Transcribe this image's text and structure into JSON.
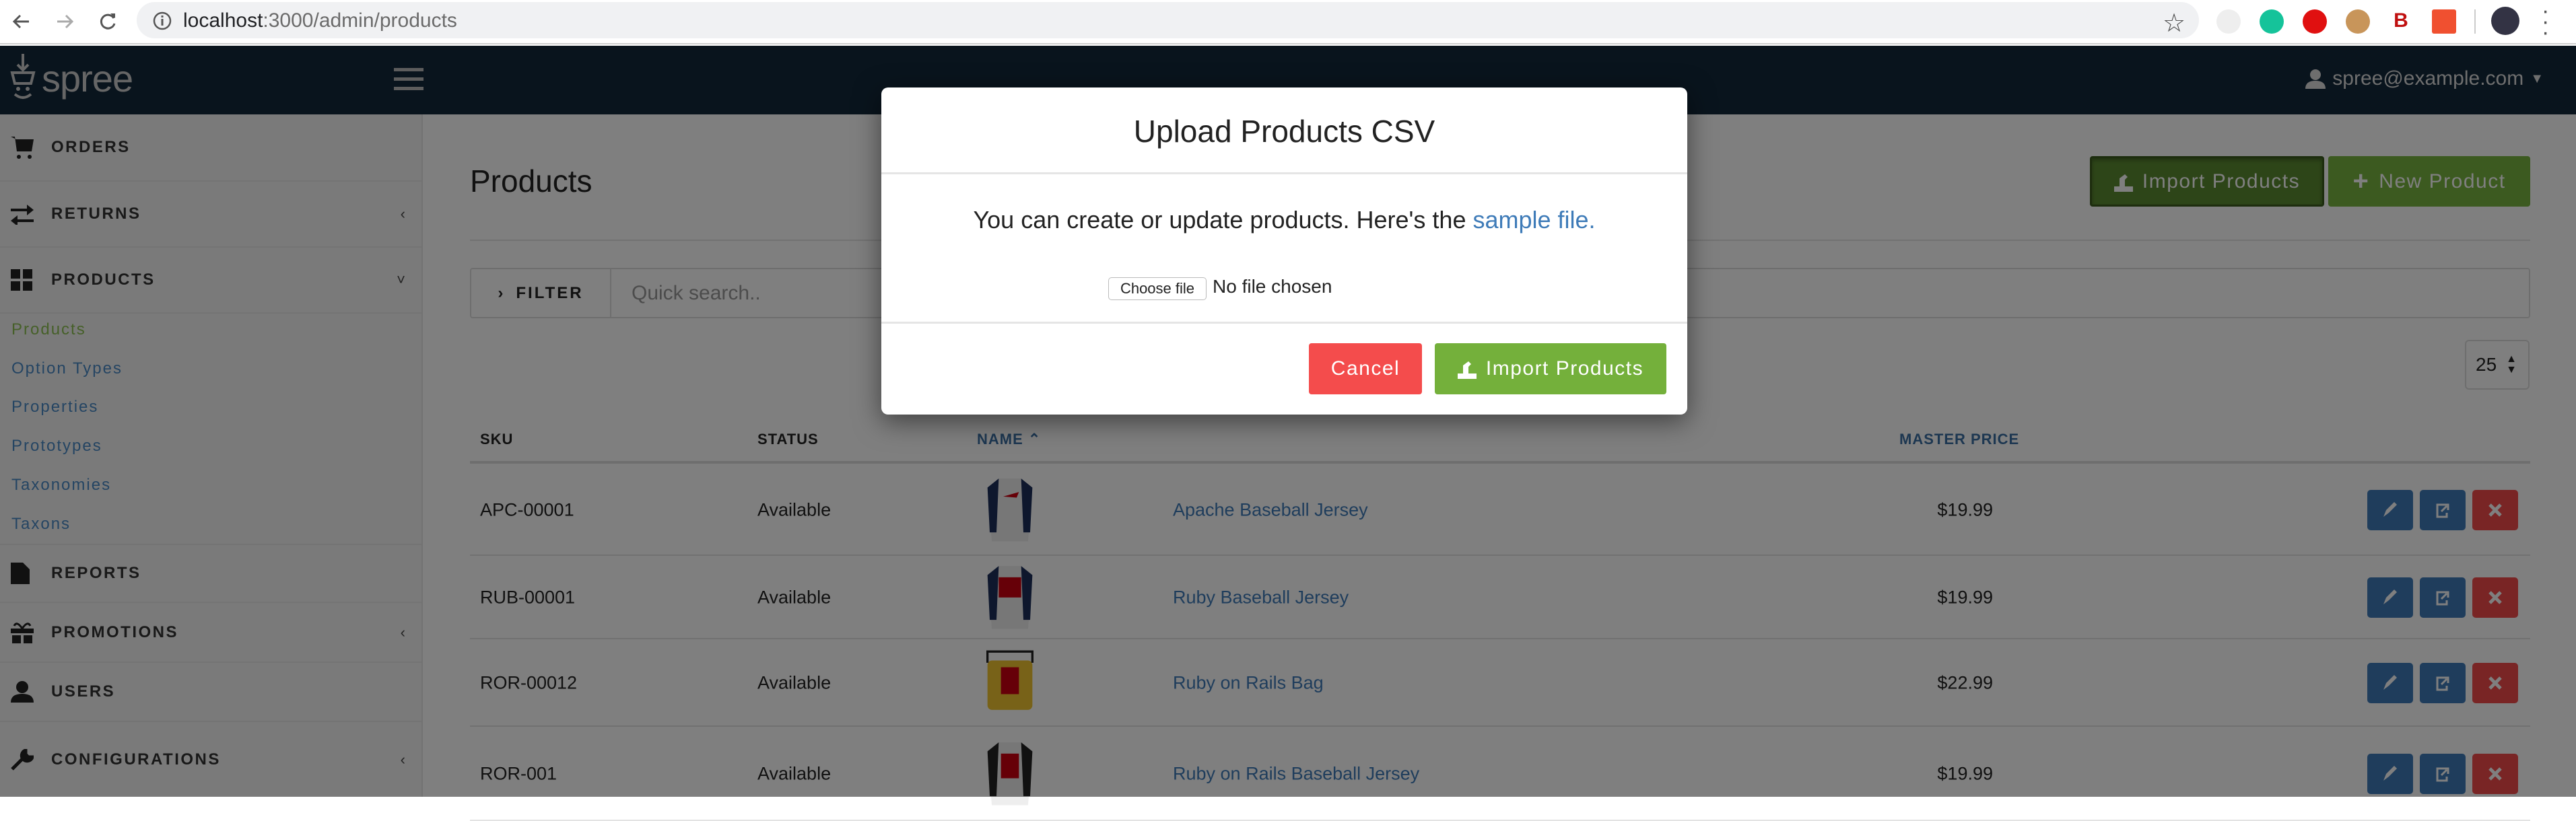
{
  "browser": {
    "url_host": "localhost",
    "url_path": ":3000/admin/products"
  },
  "header": {
    "logo": "spree",
    "user_email": "spree@example.com"
  },
  "sidebar": {
    "items": [
      {
        "label": "ORDERS",
        "icon": "cart-icon",
        "chevron": ""
      },
      {
        "label": "RETURNS",
        "icon": "exchange-icon",
        "chevron": "‹"
      },
      {
        "label": "PRODUCTS",
        "icon": "grid-icon",
        "chevron": "˅"
      },
      {
        "label": "REPORTS",
        "icon": "file-icon",
        "chevron": ""
      },
      {
        "label": "PROMOTIONS",
        "icon": "gift-icon",
        "chevron": "‹"
      },
      {
        "label": "USERS",
        "icon": "user-icon",
        "chevron": ""
      },
      {
        "label": "CONFIGURATIONS",
        "icon": "wrench-icon",
        "chevron": "‹"
      }
    ],
    "subitems": [
      {
        "label": "Products",
        "active": true
      },
      {
        "label": "Option Types"
      },
      {
        "label": "Properties"
      },
      {
        "label": "Prototypes"
      },
      {
        "label": "Taxonomies"
      },
      {
        "label": "Taxons"
      }
    ]
  },
  "main": {
    "title": "Products",
    "import_label": "Import Products",
    "new_label": "New Product",
    "filter_label": "FILTER",
    "search_placeholder": "Quick search..",
    "per_page": "25",
    "columns": {
      "sku": "SKU",
      "status": "STATUS",
      "name": "NAME",
      "price": "MASTER PRICE"
    },
    "rows": [
      {
        "sku": "APC-00001",
        "status": "Available",
        "image": "apache-jersey",
        "name": "Apache Baseball Jersey",
        "price": "$19.99"
      },
      {
        "sku": "RUB-00001",
        "status": "Available",
        "image": "ruby-jersey",
        "name": "Ruby Baseball Jersey",
        "price": "$19.99"
      },
      {
        "sku": "ROR-00012",
        "status": "Available",
        "image": "rails-bag",
        "name": "Ruby on Rails Bag",
        "price": "$22.99"
      },
      {
        "sku": "ROR-001",
        "status": "Available",
        "image": "rails-jersey",
        "name": "Ruby on Rails Baseball Jersey",
        "price": "$19.99"
      }
    ]
  },
  "modal": {
    "title": "Upload Products CSV",
    "body_text": "You can create or update products. Here's the ",
    "link_text": "sample file.",
    "choose_file": "Choose file",
    "no_file": "No file chosen",
    "cancel": "Cancel",
    "import": "Import Products"
  },
  "colors": {
    "primary": "#3e7bb8",
    "success": "#74b03b",
    "danger": "#f44c4c",
    "header": "#12283a"
  }
}
